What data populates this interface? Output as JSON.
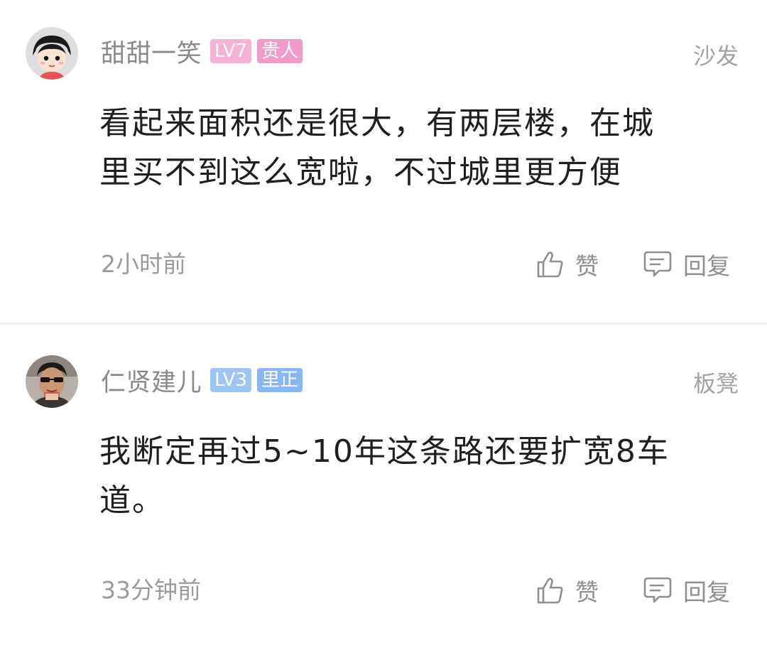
{
  "comments": [
    {
      "username": "甜甜一笑",
      "level": "LV7",
      "title": "贵人",
      "seat": "沙发",
      "lines": [
        "看起来面积还是很大，有两层楼，在城",
        "里买不到这么宽啦，不过城里更方便"
      ],
      "time": "2小时前",
      "like_label": "赞",
      "reply_label": "回复",
      "avatar_icon": "cartoon-girl-avatar"
    },
    {
      "username": "仁贤建儿",
      "level": "LV3",
      "title": "里正",
      "seat": "板凳",
      "lines": [
        "我断定再过5~10年这条路还要扩宽8车",
        "道。"
      ],
      "time": "33分钟前",
      "like_label": "赞",
      "reply_label": "回复",
      "avatar_icon": "man-with-sunglasses-avatar"
    }
  ],
  "colors": {
    "badge_level_1": "#f6b1d6",
    "badge_title_1": "#f29ac9",
    "badge_level_2": "#9cc4f5",
    "badge_title_2": "#86b6f3",
    "meta_text": "#9b9b9b"
  },
  "icons": {
    "like": "thumbs-up-icon",
    "reply": "comment-bubble-icon"
  }
}
